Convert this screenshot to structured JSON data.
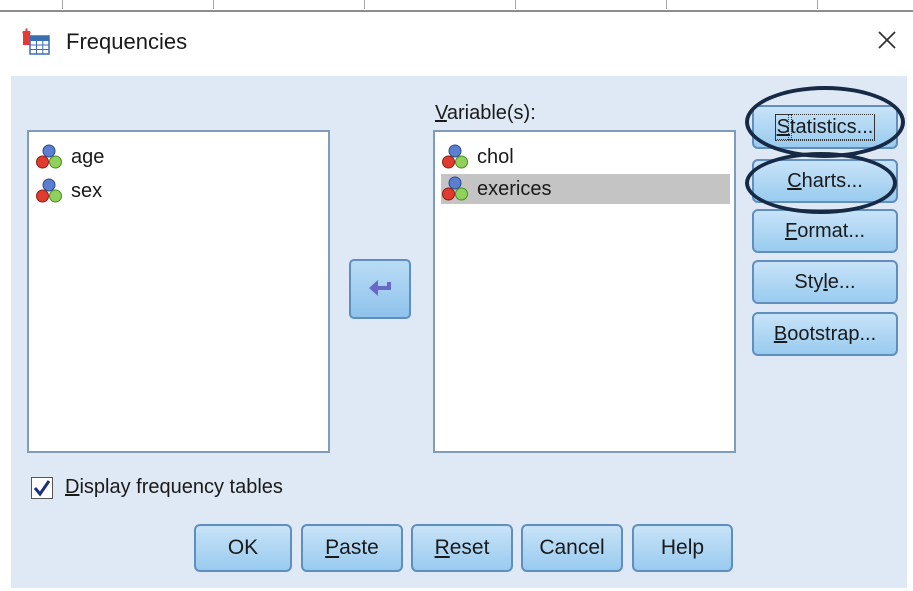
{
  "window": {
    "title": "Frequencies",
    "close_icon": "close-icon",
    "app_icon": "spss-frequencies-icon"
  },
  "source_list": {
    "items": [
      {
        "label": "age",
        "icon": "nominal-variable-icon"
      },
      {
        "label": "sex",
        "icon": "nominal-variable-icon"
      }
    ]
  },
  "variables": {
    "label_accel": "V",
    "label_rest": "ariable(s):",
    "items": [
      {
        "label": "chol",
        "icon": "nominal-variable-icon",
        "selected": false
      },
      {
        "label": "exerices",
        "icon": "nominal-variable-icon",
        "selected": true
      }
    ]
  },
  "move_button": {
    "icon": "arrow-left-icon"
  },
  "side_buttons": {
    "statistics": {
      "accel": "S",
      "rest": "tatistics..."
    },
    "charts": {
      "accel": "C",
      "rest": "harts..."
    },
    "format": {
      "accel": "F",
      "rest": "ormat..."
    },
    "style_btn": {
      "pre": "Sty",
      "accel": "l",
      "rest": "e..."
    },
    "bootstrap": {
      "accel": "B",
      "rest": "ootstrap..."
    }
  },
  "display_freq": {
    "checked": true,
    "accel": "D",
    "rest": "isplay frequency tables"
  },
  "bottom_buttons": {
    "ok": "OK",
    "paste": {
      "accel": "P",
      "rest": "aste"
    },
    "reset": {
      "accel": "R",
      "rest": "eset"
    },
    "cancel": "Cancel",
    "help": "Help"
  },
  "colors": {
    "dialog_bg": "#dfe9f5",
    "button_border": "#5f8ebf",
    "highlight_ring": "#162a45",
    "selection": "#c4c4c4"
  }
}
